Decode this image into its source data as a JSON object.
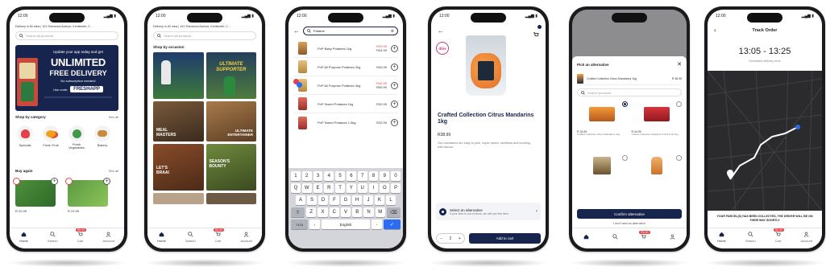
{
  "colors": {
    "navy": "#17244d",
    "red": "#e5404a",
    "accent_blue": "#2a6df4",
    "dark_map": "#2b2b2e"
  },
  "common": {
    "status_time": "12:00",
    "nav": {
      "home": "Home",
      "search": "Search",
      "cart": "Cart",
      "account": "Account",
      "cart_badge": "R0.00"
    }
  },
  "screen1": {
    "address": "Delivery in 60 mins | 101 Sherwood Avenue, Kenilworth, C...",
    "search_placeholder": "Search all products",
    "banner": {
      "line1": "Update your app today and get",
      "headline1": "UNLIMITED",
      "headline2": "FREE DELIVERY",
      "note": "No subscription needed!",
      "code_prefix": "Use code:",
      "code": "FRESHAPP"
    },
    "shop_by_category": "Shop by category",
    "see_all": "See all",
    "categories": [
      "Specials",
      "Fresh Fruit",
      "Fresh Vegetables",
      "Bakery"
    ],
    "buy_again": "Buy again",
    "buy_again_prices": [
      "R 22.99",
      "R 22.99"
    ]
  },
  "screen2": {
    "address": "Delivery in 60 mins | 101 Sherwood Avenue, Kenilworth, C...",
    "search_placeholder": "Search all products",
    "shop_by_occasion": "Shop by occasion",
    "tiles": [
      "ULTIMATE SUPPORTER",
      "",
      "MEAL MASTERS",
      "ULTIMATE ENTERTAINER",
      "LET'S BRAAI",
      "SEASON'S BOUNTY",
      "",
      ""
    ]
  },
  "screen3": {
    "search_value": "Potatoe",
    "results": [
      {
        "name": "PnP Baby Potatoes 1kg",
        "price_old": "R29.99",
        "price": "R44.99"
      },
      {
        "name": "PnP All Purpose Potatoes 2kg",
        "price_old": "",
        "price": "R40.99"
      },
      {
        "name": "PnP All Purpose Potatoes 4kg",
        "price_old": "R42.99",
        "price": "R59.99"
      },
      {
        "name": "PnP Sweet Potatoes 1kg",
        "price_old": "",
        "price": "R32.99"
      },
      {
        "name": "PnP Sweet Potatoes 1.5kg",
        "price_old": "",
        "price": "R32.99"
      }
    ],
    "keyboard": {
      "row0": [
        "1",
        "2",
        "3",
        "4",
        "5",
        "6",
        "7",
        "8",
        "9",
        "0"
      ],
      "row1": [
        "Q",
        "W",
        "E",
        "R",
        "T",
        "Y",
        "U",
        "I",
        "O",
        "P"
      ],
      "row2": [
        "A",
        "S",
        "D",
        "F",
        "G",
        "H",
        "J",
        "K",
        "L"
      ],
      "row3": [
        "Z",
        "X",
        "C",
        "V",
        "B",
        "N",
        "M"
      ],
      "mode_key": "?123",
      "comma": ",",
      "space": "English",
      "period": "."
    }
  },
  "screen4": {
    "brand_badge": "dibs",
    "title": "Crafted Collection Citrus Mandarins 1kg",
    "price": "R38.99",
    "description": "Our mandarins are easy to peel, super sweet, seedless and bursting with flavour.",
    "alt_title": "Select an alternative",
    "alt_sub": "If your item is out of stock, we will use this item.",
    "quantity": "2",
    "add_to_cart": "Add to cart"
  },
  "screen5": {
    "sheet_title": "Pick an alternative",
    "current_item": "Crafted Collection Citrus Mandarins 1kg",
    "current_price": "R 38.99",
    "search_placeholder": "Search products",
    "alternatives": [
      {
        "price": "R 34.99",
        "name": "Crafted Collection Citrus Mandarins 1kg"
      },
      {
        "price": "R 44.99",
        "name": "Crafted Collection Naartjies & Kiwi Fruit 1kg"
      },
      {
        "price": "",
        "name": ""
      },
      {
        "price": "",
        "name": ""
      }
    ],
    "confirm": "Confirm alternative",
    "no_alt": "I don't want an alternative"
  },
  "screen6": {
    "title": "Track Order",
    "time_range": "13:05 - 13:25",
    "time_label": "Estimated delivery time",
    "message": "YOUR PARCEL(S) HAS BEEN COLLECTED, THE DRIVER WILL BE ON THEIR WAY SHORTLY"
  }
}
